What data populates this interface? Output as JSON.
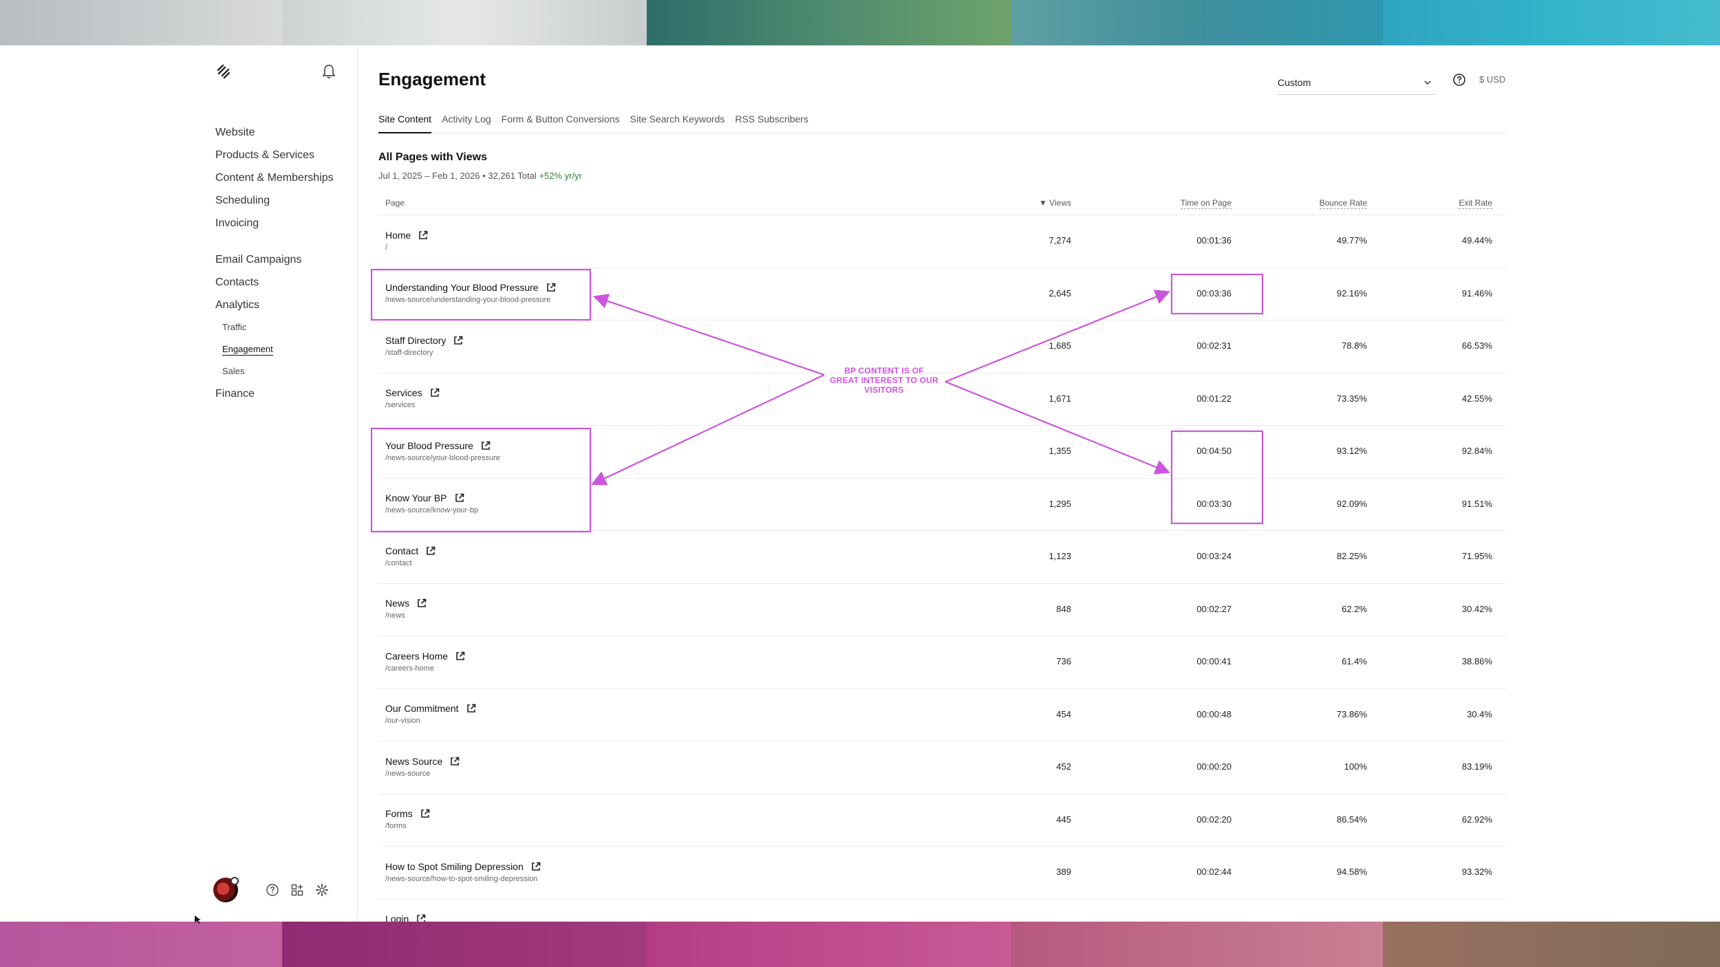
{
  "sidebar": {
    "nav": [
      "Website",
      "Products & Services",
      "Content & Memberships",
      "Scheduling",
      "Invoicing"
    ],
    "nav2": [
      "Email Campaigns",
      "Contacts",
      "Analytics"
    ],
    "analytics_sub": [
      "Traffic",
      "Engagement",
      "Sales"
    ],
    "nav3": [
      "Finance"
    ]
  },
  "header": {
    "title": "Engagement",
    "range_value": "Custom",
    "currency": "$ USD"
  },
  "tabs": [
    "Site Content",
    "Activity Log",
    "Form & Button Conversions",
    "Site Search Keywords",
    "RSS Subscribers"
  ],
  "section": {
    "title": "All Pages with Views",
    "subtitle": "Jul 1, 2025 – Feb 1, 2026 • 32,261 Total",
    "change": "+52% yr/yr"
  },
  "table": {
    "columns": {
      "page": "Page",
      "views": "Views",
      "time": "Time on Page",
      "bounce": "Bounce Rate",
      "exit": "Exit Rate"
    },
    "rows": [
      {
        "page": "Home",
        "path": "/",
        "views": "7,274",
        "time": "00:01:36",
        "bounce": "49.77%",
        "exit": "49.44%"
      },
      {
        "page": "Understanding Your Blood Pressure",
        "path": "/news-source/understanding-your-blood-pressure",
        "views": "2,645",
        "time": "00:03:36",
        "bounce": "92.16%",
        "exit": "91.46%"
      },
      {
        "page": "Staff Directory",
        "path": "/staff-directory",
        "views": "1,685",
        "time": "00:02:31",
        "bounce": "78.8%",
        "exit": "66.53%"
      },
      {
        "page": "Services",
        "path": "/services",
        "views": "1,671",
        "time": "00:01:22",
        "bounce": "73.35%",
        "exit": "42.55%"
      },
      {
        "page": "Your Blood Pressure",
        "path": "/news-source/your-blood-pressure",
        "views": "1,355",
        "time": "00:04:50",
        "bounce": "93.12%",
        "exit": "92.84%"
      },
      {
        "page": "Know Your BP",
        "path": "/news-source/know-your-bp",
        "views": "1,295",
        "time": "00:03:30",
        "bounce": "92.09%",
        "exit": "91.51%"
      },
      {
        "page": "Contact",
        "path": "/contact",
        "views": "1,123",
        "time": "00:03:24",
        "bounce": "82.25%",
        "exit": "71.95%"
      },
      {
        "page": "News",
        "path": "/news",
        "views": "848",
        "time": "00:02:27",
        "bounce": "62.2%",
        "exit": "30.42%"
      },
      {
        "page": "Careers Home",
        "path": "/careers-home",
        "views": "736",
        "time": "00:00:41",
        "bounce": "61.4%",
        "exit": "38.86%"
      },
      {
        "page": "Our Commitment",
        "path": "/our-vision",
        "views": "454",
        "time": "00:00:48",
        "bounce": "73.86%",
        "exit": "30.4%"
      },
      {
        "page": "News Source",
        "path": "/news-source",
        "views": "452",
        "time": "00:00:20",
        "bounce": "100%",
        "exit": "83.19%"
      },
      {
        "page": "Forms",
        "path": "/forms",
        "views": "445",
        "time": "00:02:20",
        "bounce": "86.54%",
        "exit": "62.92%"
      },
      {
        "page": "How to Spot Smiling Depression",
        "path": "/news-source/how-to-spot-smiling-depression",
        "views": "389",
        "time": "00:02:44",
        "bounce": "94.58%",
        "exit": "93.32%"
      },
      {
        "page": "Login",
        "path": "",
        "views": "",
        "time": "",
        "bounce": "",
        "exit": ""
      }
    ]
  },
  "annotation": {
    "line1": "BP CONTENT IS OF",
    "line2": "GREAT INTEREST TO OUR",
    "line3": "VISITORS",
    "color": "#cc55dd"
  },
  "colors": {
    "accent_positive": "#2e7d3c",
    "annotation": "#cc55dd"
  },
  "icons": [
    "squarespace-logo-icon",
    "bell-icon",
    "chevron-down-icon",
    "help-icon",
    "external-link-icon",
    "apps-icon",
    "gear-icon"
  ]
}
